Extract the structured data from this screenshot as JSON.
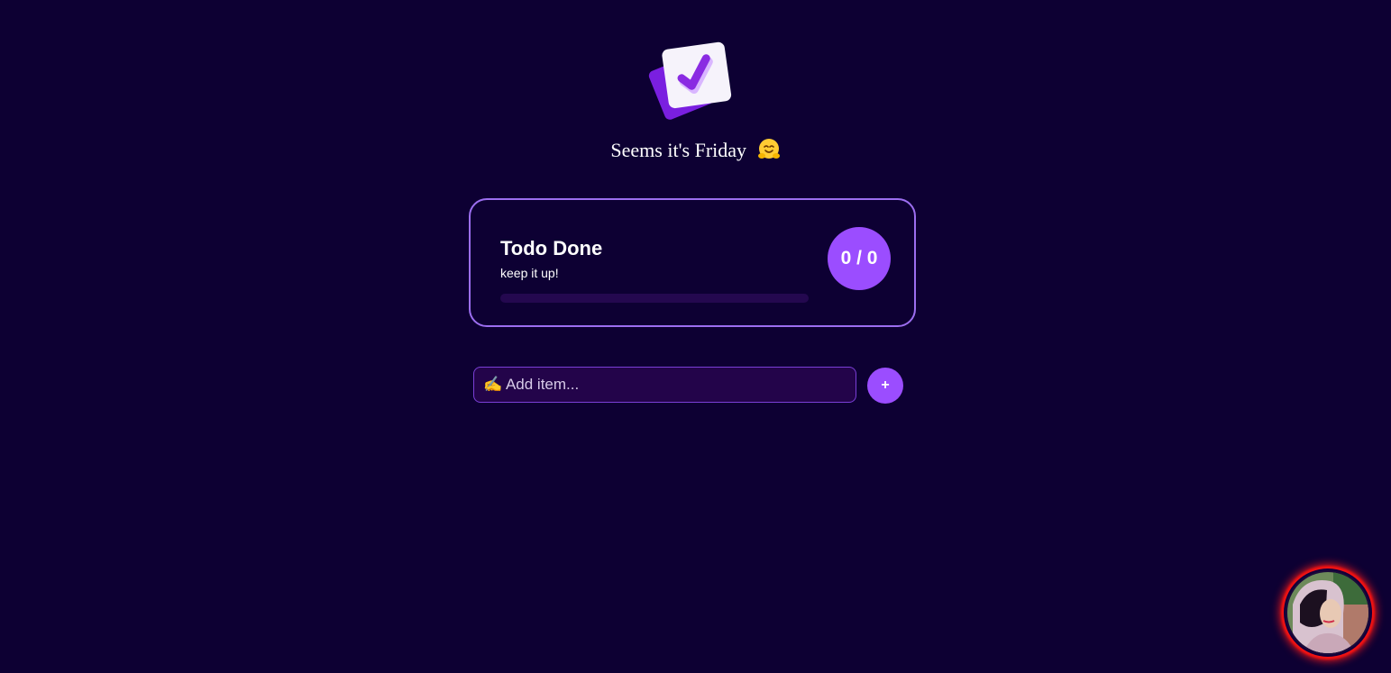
{
  "header": {
    "logo_icon": "checkbox-check-icon",
    "greeting": "Seems it's Friday",
    "greeting_emoji": "hugging-face-emoji"
  },
  "progress_card": {
    "title": "Todo Done",
    "subtitle": "keep it up!",
    "done": 0,
    "total": 0,
    "count_label": "0 / 0",
    "progress_percent": 0
  },
  "add_item": {
    "placeholder": "✍️ Add item...",
    "value": "",
    "button_label": "+"
  },
  "colors": {
    "background": "#0d0033",
    "accent": "#9b4dff",
    "card_border": "#9c6ef0",
    "input_bg": "#23044a",
    "avatar_ring": "#ff1a1a"
  },
  "profile": {
    "avatar_icon": "user-avatar-photo"
  }
}
